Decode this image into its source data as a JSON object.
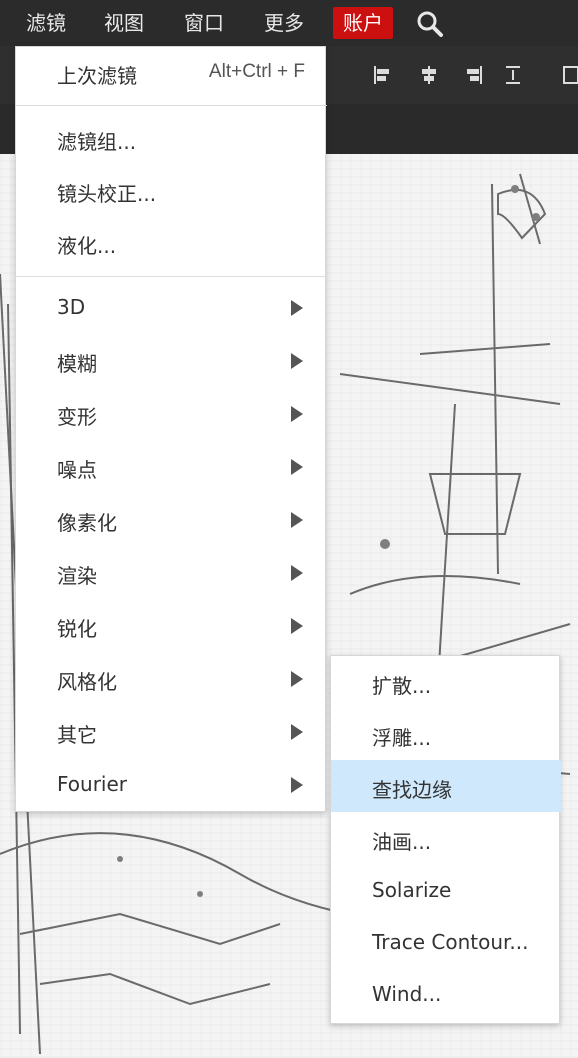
{
  "topbar": {
    "menus": [
      {
        "label": "滤镜",
        "active": false
      },
      {
        "label": "视图",
        "active": false
      },
      {
        "label": "窗口",
        "active": false
      },
      {
        "label": "更多",
        "active": false
      },
      {
        "label": "账户",
        "active": true
      }
    ],
    "search_icon": "search-icon"
  },
  "dropdown": {
    "last_filter": {
      "label": "上次滤镜",
      "shortcut": "Alt+Ctrl + F"
    },
    "group2": [
      {
        "label": "滤镜组..."
      },
      {
        "label": "镜头校正..."
      },
      {
        "label": "液化..."
      }
    ],
    "submenus": [
      {
        "label": "3D"
      },
      {
        "label": "模糊"
      },
      {
        "label": "变形"
      },
      {
        "label": "噪点"
      },
      {
        "label": "像素化"
      },
      {
        "label": "渲染"
      },
      {
        "label": "锐化"
      },
      {
        "label": "风格化"
      },
      {
        "label": "其它"
      },
      {
        "label": "Fourier"
      }
    ]
  },
  "stylize_submenu": {
    "items": [
      {
        "label": "扩散...",
        "highlighted": false
      },
      {
        "label": "浮雕...",
        "highlighted": false
      },
      {
        "label": "查找边缘",
        "highlighted": true
      },
      {
        "label": "油画...",
        "highlighted": false
      },
      {
        "label": "Solarize",
        "highlighted": false
      },
      {
        "label": "Trace Contour...",
        "highlighted": false
      },
      {
        "label": "Wind...",
        "highlighted": false
      }
    ]
  },
  "colors": {
    "accent_red": "#cc0f0f",
    "highlight_blue": "#cfe8fb"
  }
}
